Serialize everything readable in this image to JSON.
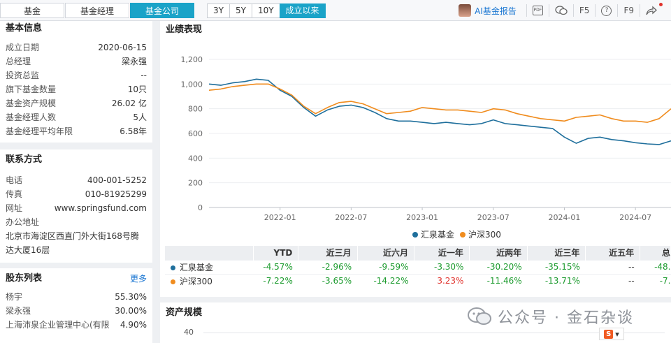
{
  "tabs": [
    {
      "label": "基金",
      "active": false
    },
    {
      "label": "基金经理",
      "active": false
    },
    {
      "label": "基金公司",
      "active": true
    }
  ],
  "periods": [
    {
      "label": "3Y",
      "active": false
    },
    {
      "label": "5Y",
      "active": false
    },
    {
      "label": "10Y",
      "active": false
    },
    {
      "label": "成立以来",
      "active": true
    }
  ],
  "toolbar": {
    "ai_report": "AI基金报告",
    "pdf_label": "PDF",
    "f5": "F5",
    "help": "?",
    "f9": "F9"
  },
  "basic_info": {
    "title": "基本信息",
    "rows": [
      {
        "k": "成立日期",
        "v": "2020-06-15"
      },
      {
        "k": "总经理",
        "v": "梁永强"
      },
      {
        "k": "投资总监",
        "v": "--"
      },
      {
        "k": "旗下基金数量",
        "v": "10只"
      },
      {
        "k": "基金资产规模",
        "v": "26.02 亿"
      },
      {
        "k": "基金经理人数",
        "v": "5人"
      },
      {
        "k": "基金经理平均年限",
        "v": "6.58年"
      }
    ]
  },
  "contact": {
    "title": "联系方式",
    "rows": [
      {
        "k": "电话",
        "v": "400-001-5252"
      },
      {
        "k": "传真",
        "v": "010-81925299"
      },
      {
        "k": "网址",
        "v": "www.springsfund.com"
      }
    ],
    "address_label": "办公地址",
    "address_line1": "北京市海淀区西直门外大街168号腾",
    "address_line2": "达大厦16层"
  },
  "shareholders": {
    "title": "股东列表",
    "more": "更多",
    "rows": [
      {
        "k": "杨宇",
        "v": "55.30%"
      },
      {
        "k": "梁永强",
        "v": "30.00%"
      },
      {
        "k": "上海沛泉企业管理中心(有限",
        "v": "4.90%"
      }
    ]
  },
  "performance": {
    "title": "业绩表现",
    "legend": [
      {
        "name": "汇泉基金",
        "color": "#1f6f9c"
      },
      {
        "name": "沪深300",
        "color": "#f08c1e"
      }
    ],
    "table": {
      "headers": [
        "YTD",
        "近三月",
        "近六月",
        "近一年",
        "近两年",
        "近三年",
        "近五年",
        "总"
      ],
      "rows": [
        {
          "name": "汇泉基金",
          "color": "#1f6f9c",
          "values": [
            "-4.57%",
            "-2.96%",
            "-9.59%",
            "-3.30%",
            "-30.20%",
            "-35.15%",
            "--",
            "-48."
          ]
        },
        {
          "name": "沪深300",
          "color": "#f08c1e",
          "values": [
            "-7.22%",
            "-3.65%",
            "-14.22%",
            "3.23%",
            "-11.46%",
            "-13.71%",
            "--",
            "-7."
          ]
        }
      ]
    }
  },
  "asset_scale": {
    "title": "资产规模",
    "ytick": "40"
  },
  "watermark": "公众号 · 金石杂谈",
  "ime": "S",
  "chart_data": {
    "type": "line",
    "ylim": [
      0,
      1200
    ],
    "yticks": [
      "0",
      "200",
      "400",
      "600",
      "800",
      "1,000",
      "1,200"
    ],
    "xticks": [
      "2022-01",
      "2022-07",
      "2023-01",
      "2023-07",
      "2024-01",
      "2024-07"
    ],
    "x": [
      "2021-07",
      "2021-08",
      "2021-09",
      "2021-10",
      "2021-11",
      "2021-12",
      "2022-01",
      "2022-02",
      "2022-03",
      "2022-04",
      "2022-05",
      "2022-06",
      "2022-07",
      "2022-08",
      "2022-09",
      "2022-10",
      "2022-11",
      "2022-12",
      "2023-01",
      "2023-02",
      "2023-03",
      "2023-04",
      "2023-05",
      "2023-06",
      "2023-07",
      "2023-08",
      "2023-09",
      "2023-10",
      "2023-11",
      "2023-12",
      "2024-01",
      "2024-02",
      "2024-03",
      "2024-04",
      "2024-05",
      "2024-06",
      "2024-07",
      "2024-08",
      "2024-09",
      "2024-10"
    ],
    "series": [
      {
        "name": "汇泉基金",
        "color": "#1f6f9c",
        "values": [
          1000,
          990,
          1010,
          1020,
          1040,
          1030,
          950,
          900,
          810,
          740,
          790,
          820,
          830,
          810,
          770,
          720,
          700,
          700,
          690,
          680,
          690,
          680,
          670,
          680,
          710,
          680,
          670,
          660,
          650,
          640,
          570,
          520,
          560,
          570,
          550,
          540,
          525,
          515,
          510,
          540
        ]
      },
      {
        "name": "沪深300",
        "color": "#f08c1e",
        "values": [
          950,
          960,
          980,
          990,
          1000,
          1000,
          960,
          910,
          820,
          760,
          810,
          850,
          860,
          840,
          800,
          760,
          770,
          780,
          810,
          800,
          790,
          790,
          780,
          770,
          800,
          790,
          760,
          740,
          720,
          710,
          700,
          730,
          740,
          750,
          720,
          700,
          700,
          690,
          720,
          800
        ]
      }
    ]
  }
}
